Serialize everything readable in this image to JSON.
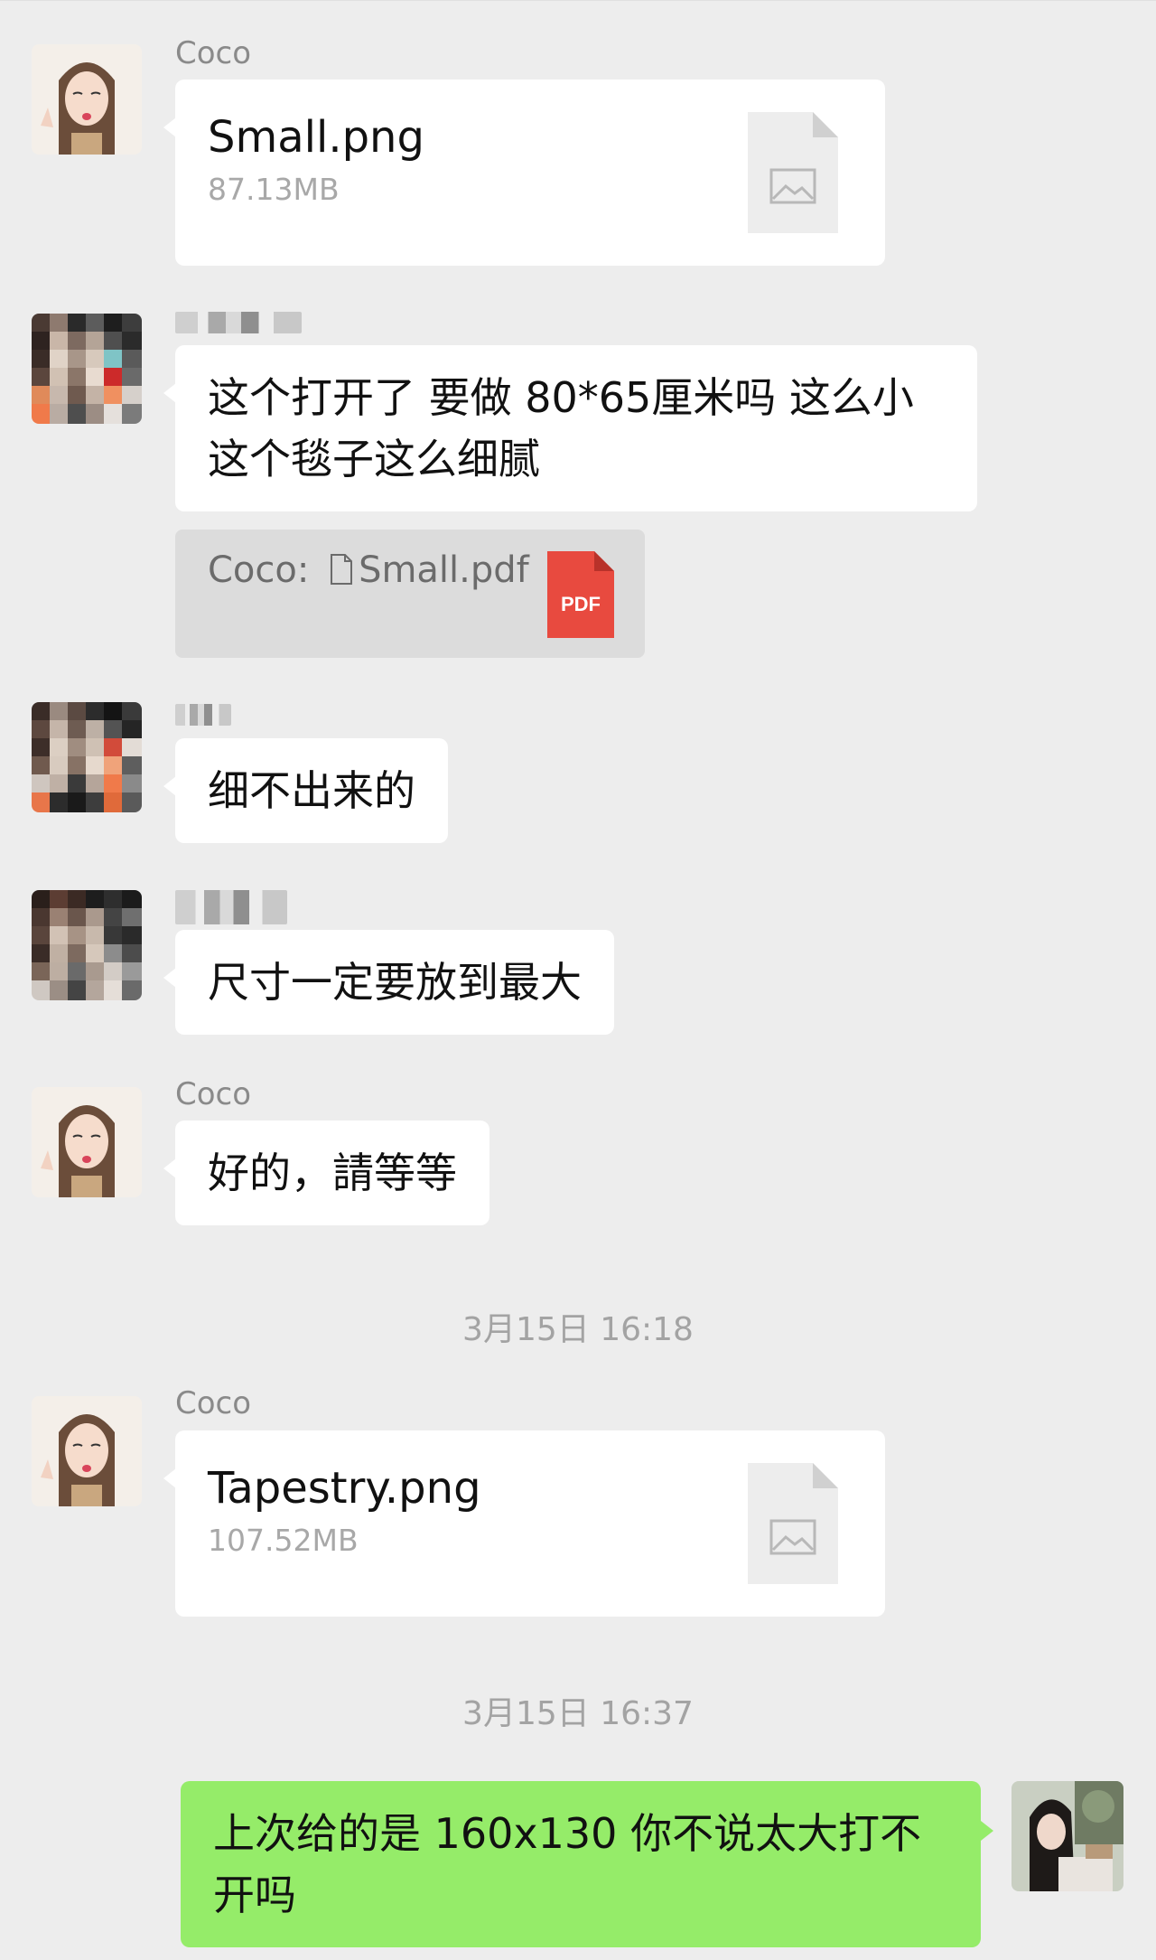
{
  "messages": [
    {
      "sender": "Coco",
      "file": {
        "name": "Small.png",
        "size": "87.13MB",
        "icon": "image-file-icon"
      }
    },
    {
      "text": "这个打开了  要做  80*65厘米吗 这么小 这个毯子这么细腻",
      "quote": {
        "prefix": "Coco:",
        "file_name": "Small.pdf",
        "icon_label": "PDF"
      }
    },
    {
      "text": "细不出来的"
    },
    {
      "text": "尺寸一定要放到最大"
    },
    {
      "sender": "Coco",
      "text": "好的，請等等"
    },
    {
      "timestamp": "3月15日 16:18"
    },
    {
      "sender": "Coco",
      "file": {
        "name": "Tapestry.png",
        "size": "107.52MB",
        "icon": "image-file-icon"
      }
    },
    {
      "timestamp": "3月15日 16:37"
    },
    {
      "self_text": "上次给的是 160x130 你不说太大打不开吗"
    }
  ],
  "colors": {
    "background": "#ededed",
    "self_bubble": "#95ec69",
    "other_bubble": "#ffffff",
    "pdf_red": "#e84a3f"
  }
}
